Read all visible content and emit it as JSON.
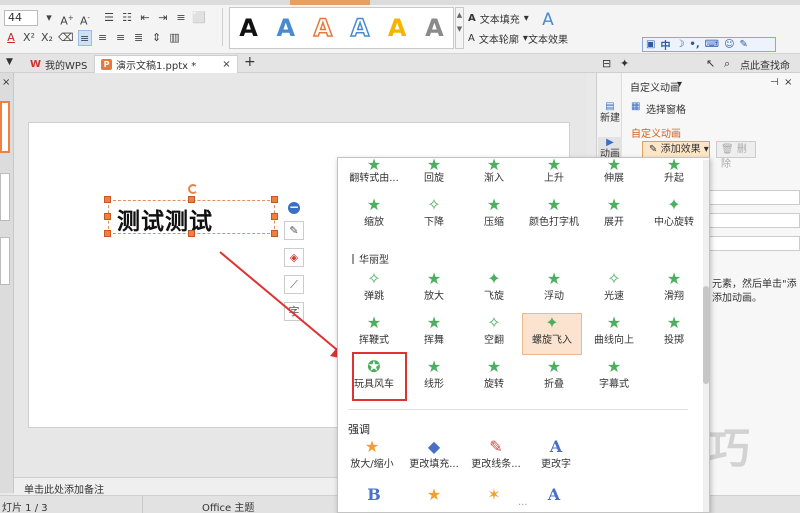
{
  "ribbon": {
    "font_size": "44",
    "wordart_sample": "A",
    "text_fill_label": "文本填充",
    "text_outline_label": "文本轮廓",
    "text_effect_label": "文本效果",
    "ime_label": "中"
  },
  "tabs": [
    {
      "label": "我的WPS",
      "icon": "wps-icon"
    },
    {
      "label": "演示文稿1.pptx *",
      "icon": "pptx-icon"
    }
  ],
  "slide": {
    "text": "测试测试"
  },
  "notes_placeholder": "单击此处添加备注",
  "status": {
    "slide_counter": "灯片 1 / 3",
    "theme": "Office 主题"
  },
  "panel": {
    "title": "自定义动画",
    "search_hint": "点此查找命",
    "new_label": "新建",
    "anim_label": "动画",
    "select_pane": "选择窗格",
    "section_title": "自定义动画",
    "add_effect": "添加效果",
    "delete": "删除",
    "hint_1": "元素，然后单击\"添",
    "hint_2": "添加动画。"
  },
  "popup": {
    "row0": [
      "翻转式由...",
      "回旋",
      "渐入",
      "上升",
      "伸展",
      "升起"
    ],
    "row1": [
      "缩放",
      "下降",
      "压缩",
      "颜色打字机",
      "展开",
      "中心旋转"
    ],
    "group_fancy": "华丽型",
    "fancy_row1": [
      "弹跳",
      "放大",
      "飞旋",
      "浮动",
      "光速",
      "滑翔"
    ],
    "fancy_row2": [
      "挥鞭式",
      "挥舞",
      "空翻",
      "螺旋飞入",
      "曲线向上",
      "投掷"
    ],
    "fancy_row3": [
      "玩具风车",
      "线形",
      "旋转",
      "折叠",
      "字幕式"
    ],
    "group_emphasis": "强调",
    "emph_row1": [
      "放大/缩小",
      "更改填充...",
      "更改线条...",
      "更改字"
    ],
    "emph_row2_icons": [
      "B",
      "star",
      "star-burst",
      "A"
    ]
  },
  "watermark": "软件技巧",
  "colors": {
    "accent_orange": "#f08040",
    "highlight_red": "#e03232",
    "star_green": "#4caf60"
  }
}
